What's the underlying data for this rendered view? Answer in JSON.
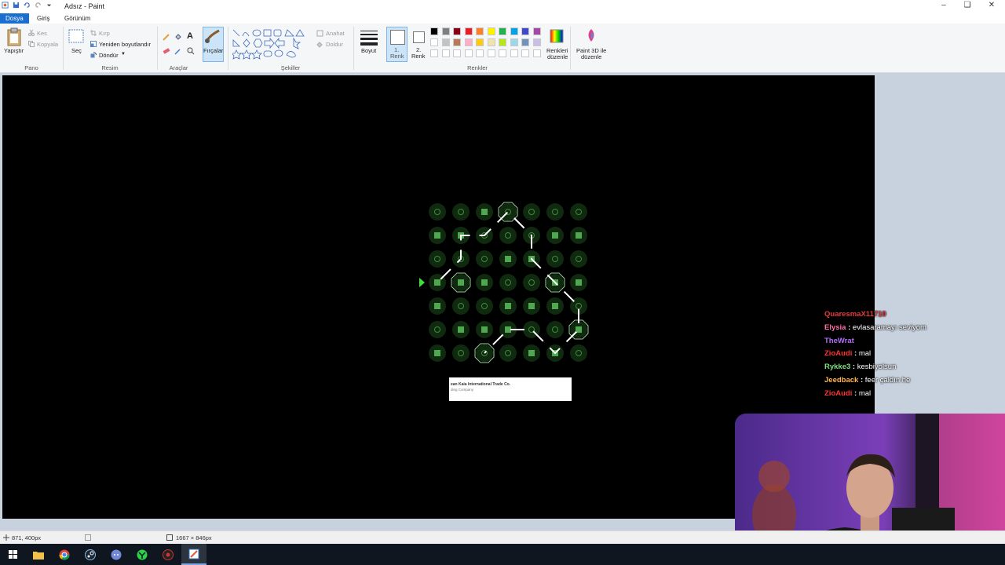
{
  "window": {
    "title": "Adsız - Paint"
  },
  "tabs": [
    {
      "label": "Dosya"
    },
    {
      "label": "Giriş"
    },
    {
      "label": "Görünüm"
    }
  ],
  "ribbon": {
    "clipboard": {
      "paste": "Yapıştır",
      "cut": "Kes",
      "copy": "Kopyala",
      "group": "Pano"
    },
    "image": {
      "select": "Seç",
      "crop": "Kırp",
      "resize": "Yeniden boyutlandır",
      "rotate": "Döndür",
      "group": "Resim"
    },
    "tools": {
      "group": "Araçlar",
      "brushes": "Fırçalar"
    },
    "shapes": {
      "outline": "Anahat",
      "fill": "Doldur",
      "group": "Şekiller"
    },
    "size": {
      "label": "Boyut"
    },
    "color1": {
      "label1": "1.",
      "label2": "Renk"
    },
    "color2": {
      "label1": "2.",
      "label2": "Renk"
    },
    "colors": {
      "group": "Renkler",
      "edit1": "Renkleri",
      "edit2": "düzenle"
    },
    "paint3d": {
      "line1": "Paint 3D ile",
      "line2": "düzenle"
    }
  },
  "palette": {
    "row1": [
      "#000000",
      "#7f7f7f",
      "#880015",
      "#ed1c24",
      "#ff7f27",
      "#fff200",
      "#22b14c",
      "#00a2e8",
      "#3f48cc",
      "#a349a4"
    ],
    "row2": [
      "#ffffff",
      "#c3c3c3",
      "#b97a57",
      "#ffaec9",
      "#ffc90e",
      "#efe4b0",
      "#b5e61d",
      "#99d9ea",
      "#7092be",
      "#c8bfe7"
    ]
  },
  "statusbar": {
    "cursor": "871, 400px",
    "size": "1667 × 846px"
  },
  "chat": [
    {
      "user": "QuaresmaX11710",
      "message": "",
      "color": "#e23b3b"
    },
    {
      "user": "Elysia",
      "message": "evlasaramayı seviyom",
      "color": "#ff6fa8"
    },
    {
      "user": "TheWrat",
      "message": "",
      "color": "#b56cff"
    },
    {
      "user": "ZioAudi",
      "message": "mal",
      "color": "#ff3333"
    },
    {
      "user": "Rykke3",
      "message": "kesbiyolsun",
      "color": "#7fe07f"
    },
    {
      "user": "Jeedback",
      "message": "feer çaldın he",
      "color": "#ffb34d"
    },
    {
      "user": "ZioAudi",
      "message": "mal",
      "color": "#ff3333"
    }
  ],
  "sheet": {
    "line1": "ean Kaia International Trade Co.",
    "line2": "ding Company"
  }
}
